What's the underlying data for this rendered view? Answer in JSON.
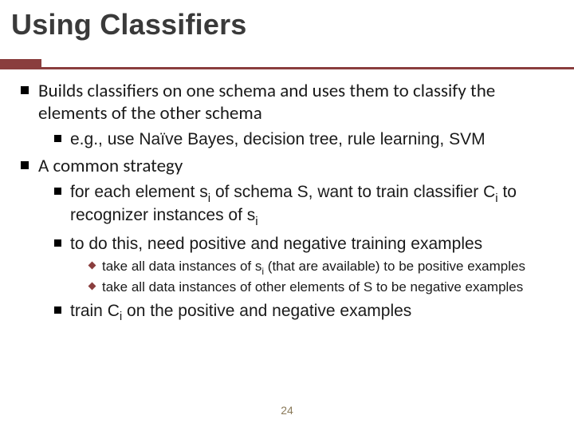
{
  "title": "Using Classifiers",
  "bullets": {
    "b1": "Builds classifiers on one schema and uses them to classify the elements of the other schema",
    "b1a": "e.g., use Naïve Bayes, decision tree, rule learning, SVM",
    "b2": "A common strategy",
    "b2a_pre": "for each element ",
    "b2a_s": "s",
    "b2a_i": "i",
    "b2a_mid1": " of schema S, want to train classifier ",
    "b2a_C": "C",
    "b2a_mid2": " to recognizer instances of ",
    "b2b": "to do this, need positive and negative training examples",
    "b2b1_pre": "take all data instances of ",
    "b2b1_post": " (that are available) to be positive examples",
    "b2b2": "take all data instances of other elements of S to be negative examples",
    "b2c_pre": "train ",
    "b2c_post": " on the positive and negative examples"
  },
  "page_number": "24"
}
